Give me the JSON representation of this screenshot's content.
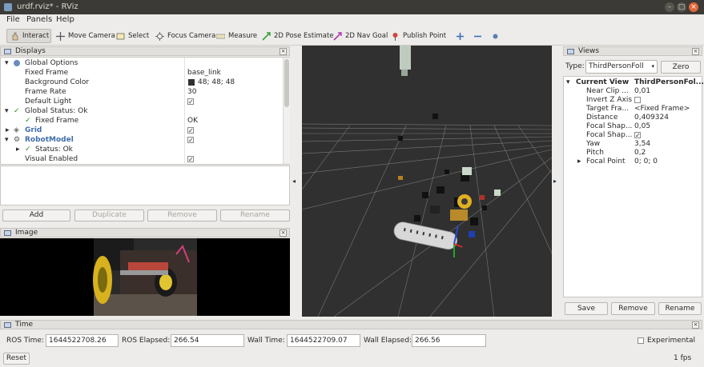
{
  "window": {
    "title": "urdf.rviz* - RViz"
  },
  "menu": {
    "file": "File",
    "panels": "Panels",
    "help": "Help"
  },
  "toolbar": {
    "interact": "Interact",
    "move_camera": "Move Camera",
    "select": "Select",
    "focus_camera": "Focus Camera",
    "measure": "Measure",
    "pose_estimate": "2D Pose Estimate",
    "nav_goal": "2D Nav Goal",
    "publish_point": "Publish Point"
  },
  "displays": {
    "title": "Displays",
    "rows": [
      {
        "label": "Global Options",
        "value": ""
      },
      {
        "label": "Fixed Frame",
        "value": "base_link"
      },
      {
        "label": "Background Color",
        "value": "48; 48; 48"
      },
      {
        "label": "Frame Rate",
        "value": "30"
      },
      {
        "label": "Default Light",
        "value": ""
      },
      {
        "label": "Global Status: Ok",
        "value": ""
      },
      {
        "label": "Fixed Frame",
        "value": "OK"
      },
      {
        "label": "Grid",
        "value": ""
      },
      {
        "label": "RobotModel",
        "value": ""
      },
      {
        "label": "Status: Ok",
        "value": ""
      },
      {
        "label": "Visual Enabled",
        "value": ""
      }
    ],
    "buttons": {
      "add": "Add",
      "duplicate": "Duplicate",
      "remove": "Remove",
      "rename": "Rename"
    }
  },
  "image_panel": {
    "title": "Image"
  },
  "views": {
    "title": "Views",
    "type_label": "Type:",
    "type_value": "ThirdPersonFoll",
    "zero": "Zero",
    "header_name": "Current View",
    "header_value": "ThirdPersonFol...",
    "rows": [
      {
        "label": "Near Clip ...",
        "value": "0,01"
      },
      {
        "label": "Invert Z Axis",
        "value": ""
      },
      {
        "label": "Target Fra...",
        "value": "<Fixed Frame>"
      },
      {
        "label": "Distance",
        "value": "0,409324"
      },
      {
        "label": "Focal Shap...",
        "value": "0,05"
      },
      {
        "label": "Focal Shap...",
        "value": ""
      },
      {
        "label": "Yaw",
        "value": "3,54"
      },
      {
        "label": "Pitch",
        "value": "0,2"
      },
      {
        "label": "Focal Point",
        "value": "0; 0; 0"
      }
    ],
    "buttons": {
      "save": "Save",
      "remove": "Remove",
      "rename": "Rename"
    }
  },
  "time": {
    "title": "Time",
    "ros_time_label": "ROS Time:",
    "ros_time": "1644522708.26",
    "ros_elapsed_label": "ROS Elapsed:",
    "ros_elapsed": "266.54",
    "wall_time_label": "Wall Time:",
    "wall_time": "1644522709.07",
    "wall_elapsed_label": "Wall Elapsed:",
    "wall_elapsed": "266.56",
    "experimental": "Experimental",
    "reset": "Reset",
    "fps": "1 fps"
  },
  "colors": {
    "background_swatch": "#303030",
    "viewport": "#303030",
    "titlebar": "#3b3a36"
  }
}
